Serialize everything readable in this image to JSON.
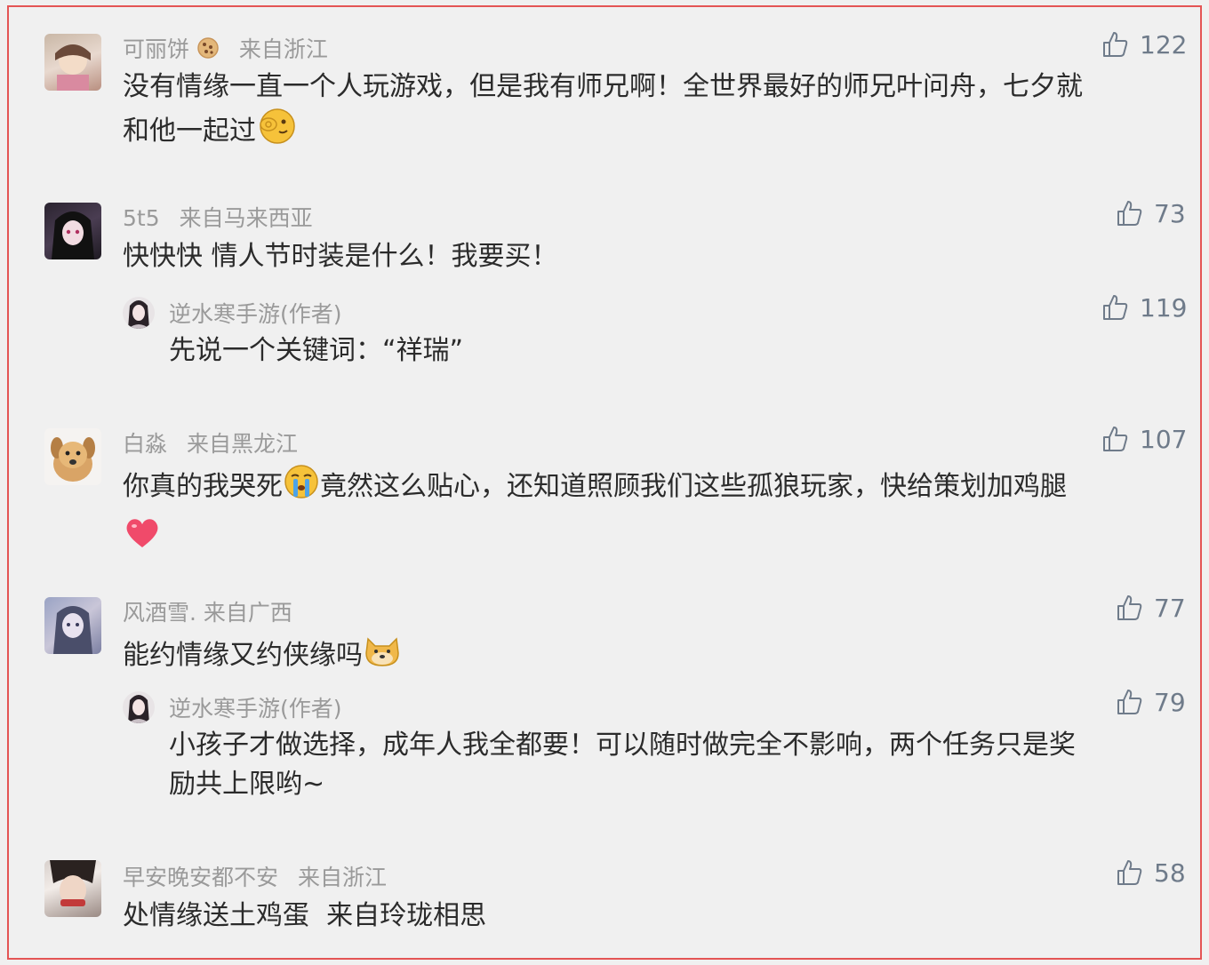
{
  "comments": [
    {
      "user": "可丽饼",
      "badge": "cookie-icon",
      "location": "来自浙江",
      "likes": "122",
      "lines": [
        "没有情缘一直一个人玩游戏，但是我有师兄啊！全世界最好的师兄叶问舟，七夕就",
        "和他一起过"
      ],
      "emoji": "ok-hand-face-emoji"
    },
    {
      "user": "5t5",
      "location": "来自马来西亚",
      "likes": "73",
      "lines": [
        "快快快 情人节时装是什么！我要买！"
      ],
      "reply": {
        "user": "逆水寒手游(作者)",
        "likes": "119",
        "lines": [
          "先说一个关键词：“祥瑞”"
        ]
      }
    },
    {
      "user": "白淼",
      "location": "来自黑龙江",
      "likes": "107",
      "lines_a": "你真的我哭死",
      "lines_b": "竟然这么贴心，还知道照顾我们这些孤狼玩家，快给策划加鸡腿",
      "emoji1": "crying-face-emoji",
      "emoji2": "heart-emoji"
    },
    {
      "user": "风酒雪.",
      "location": "来自广西",
      "likes": "77",
      "lines": [
        "能约情缘又约侠缘吗"
      ],
      "emoji": "doge-emoji",
      "reply": {
        "user": "逆水寒手游(作者)",
        "likes": "79",
        "lines": [
          "小孩子才做选择，成年人我全都要！可以随时做完全不影响，两个任务只是奖",
          "励共上限哟~"
        ]
      }
    },
    {
      "user": "早安晚安都不安",
      "location": "来自浙江",
      "likes": "58",
      "lines": [
        "处情缘送土鸡蛋  来自玲珑相思"
      ]
    }
  ]
}
